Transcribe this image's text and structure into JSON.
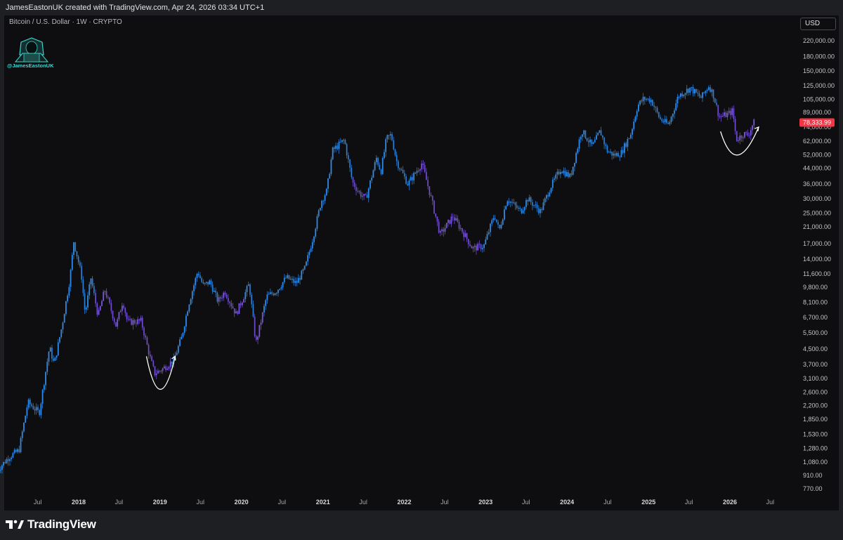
{
  "header": {
    "attribution": "JamesEastonUK created with TradingView.com, Apr 24, 2026 03:34 UTC+1"
  },
  "symbol": {
    "label": "Bitcoin / U.S. Dollar · 1W · CRYPTO"
  },
  "avatar": {
    "handle": "@JamesEastonUK",
    "icon": "hooded-hacker-avatar-icon"
  },
  "currency": {
    "label": "USD"
  },
  "footer": {
    "brand": "TradingView",
    "icon": "tradingview-logo-icon"
  },
  "colors": {
    "background": "#0e0e10",
    "frame": "#1e1f22",
    "candle_blue": "#2f8be8",
    "candle_purple": "#7a55e0",
    "price_badge": "#f23645",
    "arrow": "#ffffff"
  },
  "chart_data": {
    "type": "candlestick",
    "scale": "log",
    "ylim": [
      700,
      300000
    ],
    "current_price": {
      "value": 78333.99,
      "label": "78,333.99"
    },
    "y_ticks": [
      {
        "value": 220000,
        "label": "220,000.00"
      },
      {
        "value": 180000,
        "label": "180,000.00"
      },
      {
        "value": 150000,
        "label": "150,000.00"
      },
      {
        "value": 125000,
        "label": "125,000.00"
      },
      {
        "value": 105000,
        "label": "105,000.00"
      },
      {
        "value": 89000,
        "label": "89,000.00"
      },
      {
        "value": 74000,
        "label": "74,000.00"
      },
      {
        "value": 62000,
        "label": "62,000.00"
      },
      {
        "value": 52000,
        "label": "52,000.00"
      },
      {
        "value": 44000,
        "label": "44,000.00"
      },
      {
        "value": 36000,
        "label": "36,000.00"
      },
      {
        "value": 30000,
        "label": "30,000.00"
      },
      {
        "value": 25000,
        "label": "25,000.00"
      },
      {
        "value": 21000,
        "label": "21,000.00"
      },
      {
        "value": 17000,
        "label": "17,000.00"
      },
      {
        "value": 14000,
        "label": "14,000.00"
      },
      {
        "value": 11600,
        "label": "11,600.00"
      },
      {
        "value": 9800,
        "label": "9,800.00"
      },
      {
        "value": 8100,
        "label": "8,100.00"
      },
      {
        "value": 6700,
        "label": "6,700.00"
      },
      {
        "value": 5500,
        "label": "5,500.00"
      },
      {
        "value": 4500,
        "label": "4,500.00"
      },
      {
        "value": 3700,
        "label": "3,700.00"
      },
      {
        "value": 3100,
        "label": "3,100.00"
      },
      {
        "value": 2600,
        "label": "2,600.00"
      },
      {
        "value": 2200,
        "label": "2,200.00"
      },
      {
        "value": 1850,
        "label": "1,850.00"
      },
      {
        "value": 1530,
        "label": "1,530.00"
      },
      {
        "value": 1280,
        "label": "1,280.00"
      },
      {
        "value": 1080,
        "label": "1,080.00"
      },
      {
        "value": 910,
        "label": "910.00"
      },
      {
        "value": 770,
        "label": "770.00"
      }
    ],
    "x_ticks": [
      {
        "date": "2017-07-01",
        "label": "Jul",
        "major": false
      },
      {
        "date": "2018-01-01",
        "label": "2018",
        "major": true
      },
      {
        "date": "2018-07-01",
        "label": "Jul",
        "major": false
      },
      {
        "date": "2019-01-01",
        "label": "2019",
        "major": true
      },
      {
        "date": "2019-07-01",
        "label": "Jul",
        "major": false
      },
      {
        "date": "2020-01-01",
        "label": "2020",
        "major": true
      },
      {
        "date": "2020-07-01",
        "label": "Jul",
        "major": false
      },
      {
        "date": "2021-01-01",
        "label": "2021",
        "major": true
      },
      {
        "date": "2021-07-01",
        "label": "Jul",
        "major": false
      },
      {
        "date": "2022-01-01",
        "label": "2022",
        "major": true
      },
      {
        "date": "2022-07-01",
        "label": "Jul",
        "major": false
      },
      {
        "date": "2023-01-01",
        "label": "2023",
        "major": true
      },
      {
        "date": "2023-07-01",
        "label": "Jul",
        "major": false
      },
      {
        "date": "2024-01-01",
        "label": "2024",
        "major": true
      },
      {
        "date": "2024-07-01",
        "label": "Jul",
        "major": false
      },
      {
        "date": "2025-01-01",
        "label": "2025",
        "major": true
      },
      {
        "date": "2025-07-01",
        "label": "Jul",
        "major": false
      },
      {
        "date": "2026-01-01",
        "label": "2026",
        "major": true
      },
      {
        "date": "2026-07-01",
        "label": "Jul",
        "major": false
      }
    ],
    "price_path": [
      [
        "2017-01-01",
        950
      ],
      [
        "2017-03-01",
        1150
      ],
      [
        "2017-04-15",
        1250
      ],
      [
        "2017-05-25",
        2300
      ],
      [
        "2017-07-15",
        2000
      ],
      [
        "2017-08-30",
        4600
      ],
      [
        "2017-09-20",
        3700
      ],
      [
        "2017-10-25",
        6000
      ],
      [
        "2017-11-30",
        11000
      ],
      [
        "2017-12-17",
        17500
      ],
      [
        "2018-01-20",
        11500
      ],
      [
        "2018-02-06",
        7000
      ],
      [
        "2018-03-04",
        11000
      ],
      [
        "2018-04-05",
        6800
      ],
      [
        "2018-05-05",
        9500
      ],
      [
        "2018-06-25",
        6000
      ],
      [
        "2018-07-25",
        8300
      ],
      [
        "2018-08-15",
        6300
      ],
      [
        "2018-10-15",
        6400
      ],
      [
        "2018-11-25",
        4000
      ],
      [
        "2018-12-15",
        3300
      ],
      [
        "2019-01-20",
        3500
      ],
      [
        "2019-03-10",
        3900
      ],
      [
        "2019-04-15",
        5200
      ],
      [
        "2019-05-15",
        7800
      ],
      [
        "2019-06-26",
        12000
      ],
      [
        "2019-07-20",
        10000
      ],
      [
        "2019-08-20",
        10500
      ],
      [
        "2019-09-25",
        8200
      ],
      [
        "2019-10-26",
        9300
      ],
      [
        "2019-12-15",
        7000
      ],
      [
        "2020-02-12",
        10200
      ],
      [
        "2020-03-13",
        4800
      ],
      [
        "2020-04-30",
        8700
      ],
      [
        "2020-06-15",
        9400
      ],
      [
        "2020-07-28",
        11100
      ],
      [
        "2020-09-10",
        10300
      ],
      [
        "2020-10-20",
        12500
      ],
      [
        "2020-11-25",
        18500
      ],
      [
        "2020-12-31",
        29000
      ],
      [
        "2021-01-25",
        33000
      ],
      [
        "2021-02-20",
        55000
      ],
      [
        "2021-04-14",
        63000
      ],
      [
        "2021-05-20",
        37000
      ],
      [
        "2021-06-22",
        32000
      ],
      [
        "2021-07-20",
        30000
      ],
      [
        "2021-09-05",
        50000
      ],
      [
        "2021-09-25",
        42000
      ],
      [
        "2021-10-20",
        64000
      ],
      [
        "2021-11-10",
        67000
      ],
      [
        "2021-12-05",
        48000
      ],
      [
        "2022-01-24",
        36000
      ],
      [
        "2022-03-28",
        47000
      ],
      [
        "2022-05-12",
        29000
      ],
      [
        "2022-06-18",
        19000
      ],
      [
        "2022-08-14",
        24000
      ],
      [
        "2022-09-30",
        19500
      ],
      [
        "2022-11-10",
        16000
      ],
      [
        "2022-12-31",
        16500
      ],
      [
        "2023-02-16",
        24500
      ],
      [
        "2023-03-10",
        20000
      ],
      [
        "2023-04-14",
        30000
      ],
      [
        "2023-06-15",
        25500
      ],
      [
        "2023-07-15",
        30000
      ],
      [
        "2023-09-11",
        25500
      ],
      [
        "2023-10-25",
        34500
      ],
      [
        "2023-12-10",
        43500
      ],
      [
        "2024-01-23",
        39500
      ],
      [
        "2024-03-14",
        71000
      ],
      [
        "2024-05-01",
        58000
      ],
      [
        "2024-06-05",
        70500
      ],
      [
        "2024-07-05",
        55000
      ],
      [
        "2024-08-05",
        52000
      ],
      [
        "2024-09-06",
        53000
      ],
      [
        "2024-10-20",
        68000
      ],
      [
        "2024-11-20",
        97000
      ],
      [
        "2024-12-17",
        106000
      ],
      [
        "2025-01-20",
        104000
      ],
      [
        "2025-02-28",
        82000
      ],
      [
        "2025-04-08",
        76000
      ],
      [
        "2025-05-22",
        110000
      ],
      [
        "2025-07-14",
        121000
      ],
      [
        "2025-09-01",
        107000
      ],
      [
        "2025-10-06",
        125000
      ],
      [
        "2025-10-25",
        112000
      ],
      [
        "2025-11-21",
        84000
      ],
      [
        "2025-12-30",
        87000
      ],
      [
        "2026-01-20",
        91000
      ],
      [
        "2026-02-06",
        63000
      ],
      [
        "2026-03-10",
        68000
      ],
      [
        "2026-04-01",
        67000
      ],
      [
        "2026-04-24",
        78333
      ]
    ],
    "purple_ranges": [
      [
        "2018-03-15",
        "2019-02-20"
      ],
      [
        "2019-09-20",
        "2020-01-15"
      ],
      [
        "2020-03-01",
        "2020-04-05"
      ],
      [
        "2021-05-10",
        "2021-07-15"
      ],
      [
        "2022-03-01",
        "2022-12-15"
      ],
      [
        "2025-11-05",
        "2026-04-20"
      ]
    ],
    "annotations": [
      {
        "type": "curved-arrow",
        "from": [
          "2018-11-01",
          4100
        ],
        "via": [
          "2019-01-01",
          2700
        ],
        "to": [
          "2019-03-10",
          4100
        ]
      },
      {
        "type": "curved-arrow",
        "from": [
          "2025-11-20",
          70000
        ],
        "via": [
          "2026-01-28",
          52000
        ],
        "to": [
          "2026-05-10",
          74000
        ]
      }
    ]
  }
}
